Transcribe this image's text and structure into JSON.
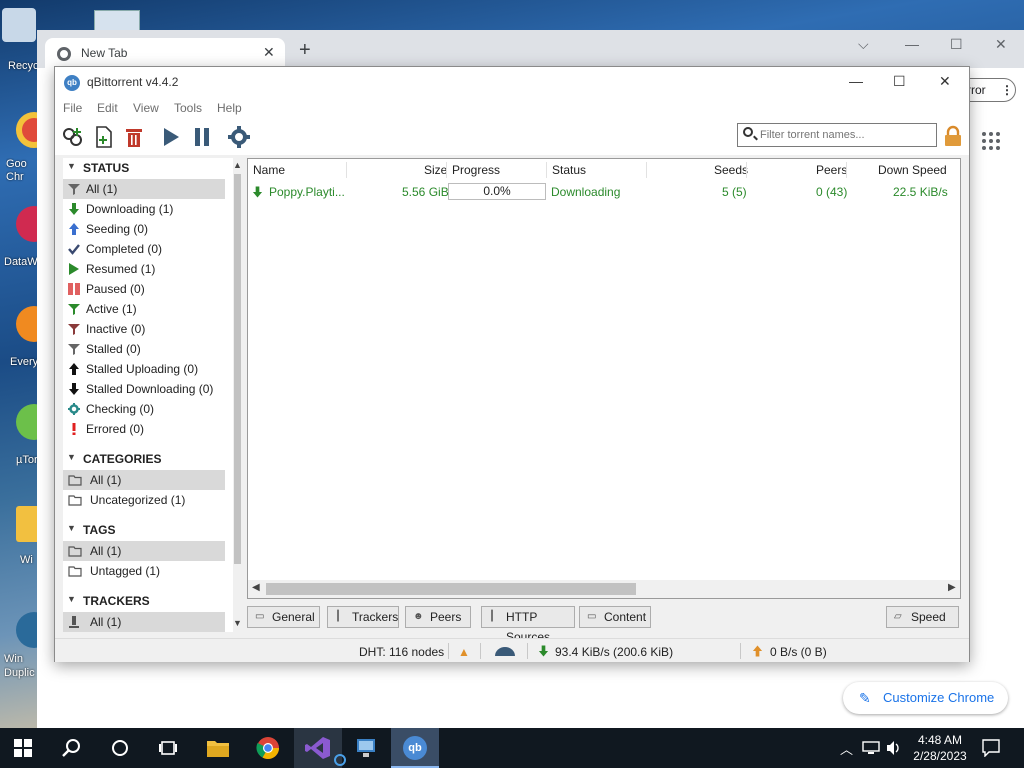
{
  "desktop": {
    "icons": [
      {
        "label": "Recyc",
        "color": "#c8d8e8"
      },
      {
        "label": "Goo Chr",
        "color": "#e04a3a"
      },
      {
        "label": "DataW",
        "color": "#d02a50"
      },
      {
        "label": "Every",
        "color": "#f08a20"
      },
      {
        "label": "µTor",
        "color": "#6cc04a"
      },
      {
        "label": "Wi",
        "color": "#f2c040"
      },
      {
        "label": "Win Duplic",
        "color": "#2a6a9a"
      }
    ]
  },
  "chrome": {
    "tab_title": "New Tab",
    "error_label": "rror",
    "customize_label": "Customize Chrome"
  },
  "qb": {
    "title": "qBittorrent v4.4.2",
    "menu": [
      "File",
      "Edit",
      "View",
      "Tools",
      "Help"
    ],
    "filter_placeholder": "Filter torrent names...",
    "sidebar": {
      "status_header": "STATUS",
      "status_items": [
        {
          "label": "All (1)",
          "icon": "filter-icon",
          "color": "#666"
        },
        {
          "label": "Downloading (1)",
          "icon": "arrow-down-icon",
          "color": "#2b8a2b"
        },
        {
          "label": "Seeding (0)",
          "icon": "arrow-up-icon",
          "color": "#3a6fcf"
        },
        {
          "label": "Completed (0)",
          "icon": "checkmark-icon",
          "color": "#3a4a70"
        },
        {
          "label": "Resumed (1)",
          "icon": "play-icon",
          "color": "#2b8a2b"
        },
        {
          "label": "Paused (0)",
          "icon": "pause-icon",
          "color": "#e06060"
        },
        {
          "label": "Active (1)",
          "icon": "filter-icon",
          "color": "#2b8a2b"
        },
        {
          "label": "Inactive (0)",
          "icon": "filter-icon",
          "color": "#8a3a3a"
        },
        {
          "label": "Stalled (0)",
          "icon": "filter-icon",
          "color": "#666"
        },
        {
          "label": "Stalled Uploading (0)",
          "icon": "arrow-up-icon",
          "color": "#111"
        },
        {
          "label": "Stalled Downloading (0)",
          "icon": "arrow-down-icon",
          "color": "#111"
        },
        {
          "label": "Checking (0)",
          "icon": "gear-icon",
          "color": "#2a8a8a"
        },
        {
          "label": "Errored (0)",
          "icon": "exclamation-icon",
          "color": "#e02020"
        }
      ],
      "categories_header": "CATEGORIES",
      "category_items": [
        "All (1)",
        "Uncategorized (1)"
      ],
      "tags_header": "TAGS",
      "tag_items": [
        "All (1)",
        "Untagged (1)"
      ],
      "trackers_header": "TRACKERS",
      "tracker_items": [
        "All (1)"
      ]
    },
    "columns": [
      "Name",
      "Size",
      "Progress",
      "Status",
      "Seeds",
      "Peers",
      "Down Speed"
    ],
    "torrent": {
      "name": "Poppy.Playti...",
      "size": "5.56 GiB",
      "progress": "0.0%",
      "status": "Downloading",
      "seeds": "5 (5)",
      "peers": "0 (43)",
      "down_speed": "22.5 KiB/s"
    },
    "prop_tabs": [
      "General",
      "Trackers",
      "Peers",
      "HTTP Sources",
      "Content"
    ],
    "speed_tab": "Speed",
    "statusbar": {
      "dht": "DHT: 116 nodes",
      "down": "93.4 KiB/s (200.6 KiB)",
      "up": "0 B/s (0 B)"
    }
  },
  "taskbar": {
    "time": "4:48 AM",
    "date": "2/28/2023"
  }
}
